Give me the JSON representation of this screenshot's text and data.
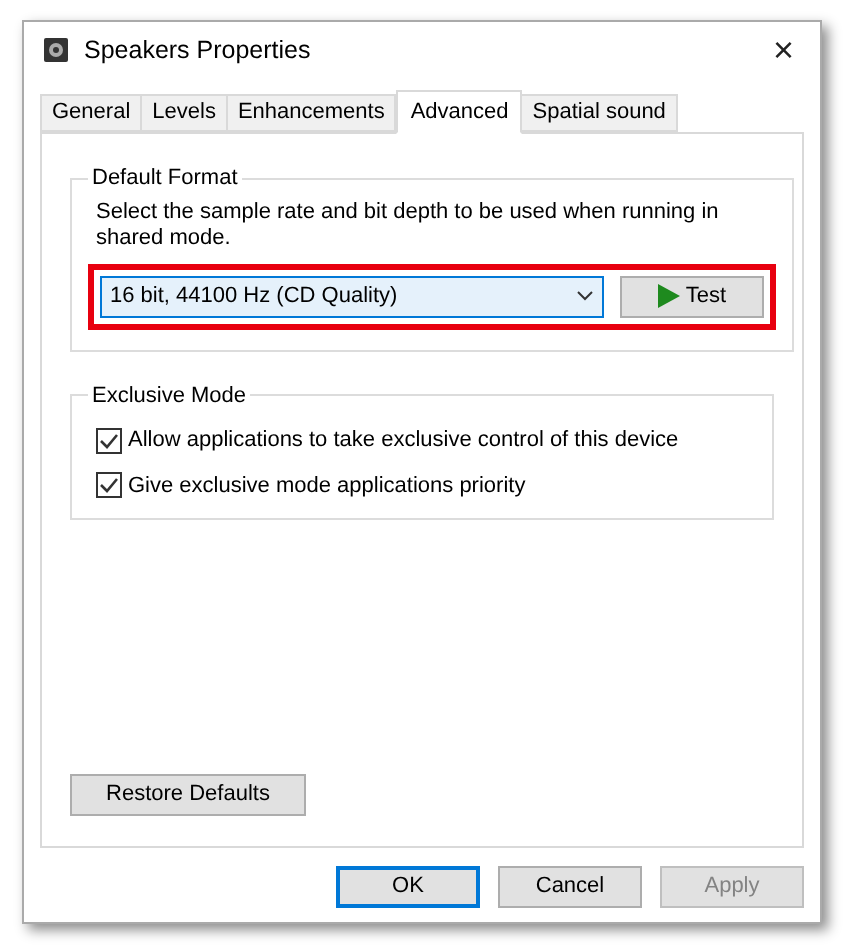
{
  "window": {
    "title": "Speakers Properties",
    "close": "×"
  },
  "tabs": [
    {
      "label": "General",
      "selected": false
    },
    {
      "label": "Levels",
      "selected": false
    },
    {
      "label": "Enhancements",
      "selected": false
    },
    {
      "label": "Advanced",
      "selected": true
    },
    {
      "label": "Spatial sound",
      "selected": false
    }
  ],
  "default_format": {
    "title": "Default Format",
    "description": "Select the sample rate and bit depth to be used when running in shared mode.",
    "highlighted": true,
    "format": "16 bit, 44100 Hz (CD Quality)",
    "test_button": "Test"
  },
  "exclusive_mode": {
    "title": "Exclusive Mode",
    "options": [
      {
        "label": "Allow applications to take exclusive control of this device",
        "checked": true
      },
      {
        "label": "Give exclusive mode applications priority",
        "checked": true
      }
    ]
  },
  "restore_button": "Restore Defaults",
  "buttons": [
    {
      "label": "OK",
      "default": true,
      "disabled": false
    },
    {
      "label": "Cancel",
      "default": false,
      "disabled": false
    },
    {
      "label": "Apply",
      "default": false,
      "disabled": true
    }
  ]
}
